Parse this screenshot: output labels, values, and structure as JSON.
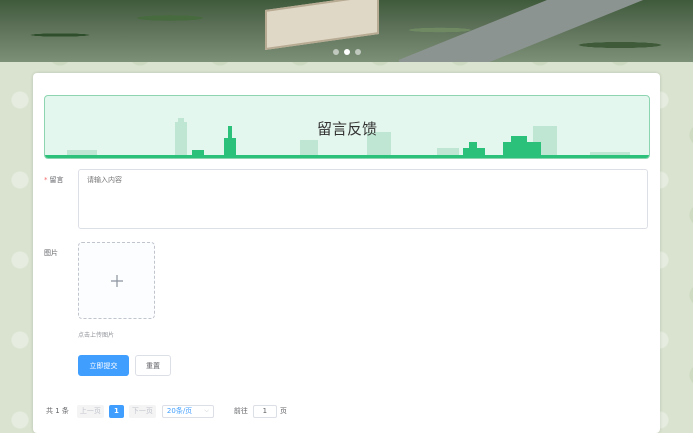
{
  "banner": {
    "slides": 3,
    "active_slide": 2
  },
  "hero": {
    "title": "留言反馈"
  },
  "form": {
    "message_label": "留言",
    "message_placeholder": "请输入内容",
    "image_label": "图片",
    "upload_tip": "点击上传图片",
    "submit_label": "立即提交",
    "reset_label": "重置"
  },
  "pagination": {
    "total_text": "共 1 条",
    "prev_label": "上一页",
    "current_page": "1",
    "next_label": "下一页",
    "page_size": "20条/页",
    "goto_prefix": "前往",
    "goto_value": "1",
    "goto_suffix": "页"
  },
  "colors": {
    "primary": "#409eff",
    "hero_bg": "#e4f7ee",
    "hero_silhouette": "#2cc17b",
    "required": "#f56c6c"
  }
}
